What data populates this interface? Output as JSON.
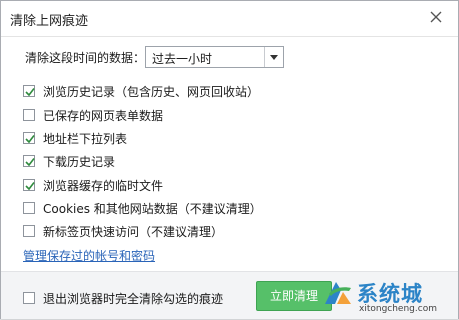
{
  "dialog": {
    "title": "清除上网痕迹"
  },
  "range": {
    "label": "清除这段时间的数据：",
    "selected": "过去一小时"
  },
  "options": [
    {
      "label": "浏览历史记录（包含历史、网页回收站）",
      "checked": true
    },
    {
      "label": "已保存的网页表单数据",
      "checked": false
    },
    {
      "label": "地址栏下拉列表",
      "checked": true
    },
    {
      "label": "下载历史记录",
      "checked": true
    },
    {
      "label": "浏览器缓存的临时文件",
      "checked": true
    },
    {
      "label": "Cookies 和其他网站数据（不建议清理）",
      "checked": false
    },
    {
      "label": "新标签页快速访问（不建议清理）",
      "checked": false
    }
  ],
  "manage_link": "管理保存过的帐号和密码",
  "footer": {
    "exit_option": "退出浏览器时完全清除勾选的痕迹",
    "exit_checked": false,
    "primary_button": "立即清理"
  },
  "watermark": {
    "brand": "系统城",
    "url": "xitongcheng.com"
  },
  "colors": {
    "accent": "#56c069",
    "link": "#2a64b8",
    "check": "#2f8b3e",
    "watermark": "#2c84c7"
  }
}
